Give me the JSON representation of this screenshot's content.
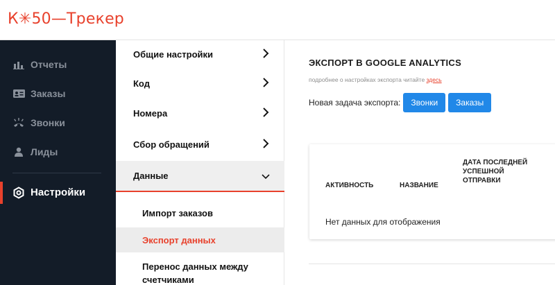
{
  "logo": {
    "text": "К✳50—Трекер"
  },
  "sidebar": {
    "items": [
      {
        "label": "Отчеты",
        "icon": "bar-chart-icon"
      },
      {
        "label": "Заказы",
        "icon": "id-card-icon"
      },
      {
        "label": "Звонки",
        "icon": "phone-ringing-icon"
      },
      {
        "label": "Лиды",
        "icon": "person-icon"
      }
    ],
    "active": {
      "label": "Настройки",
      "icon": "gear-icon"
    }
  },
  "settings": {
    "items": [
      {
        "label": "Общие настройки"
      },
      {
        "label": "Код"
      },
      {
        "label": "Номера"
      },
      {
        "label": "Сбор обращений"
      },
      {
        "label": "Данные"
      }
    ],
    "sub_items": [
      {
        "label": "Импорт заказов"
      },
      {
        "label": "Экспорт данных"
      },
      {
        "label": "Перенос данных между счетчиками"
      }
    ]
  },
  "main": {
    "title": "ЭКСПОРТ В GOOGLE ANALYTICS",
    "subtitle_text": "подробнее о настройках экспорта читайте",
    "subtitle_link": "здесь",
    "task_label": "Новая задача экспорта:",
    "buttons": [
      "Звонки",
      "Заказы"
    ],
    "table": {
      "headers": [
        "АКТИВНОСТЬ",
        "НАЗВАНИЕ",
        "ДАТА ПОСЛЕДНЕЙ УСПЕШНОЙ ОТПРАВКИ"
      ],
      "empty_text": "Нет данных для отображения"
    }
  },
  "colors": {
    "accent": "#e8412c",
    "sidebar_bg": "#131c28",
    "button": "#2188e8"
  }
}
